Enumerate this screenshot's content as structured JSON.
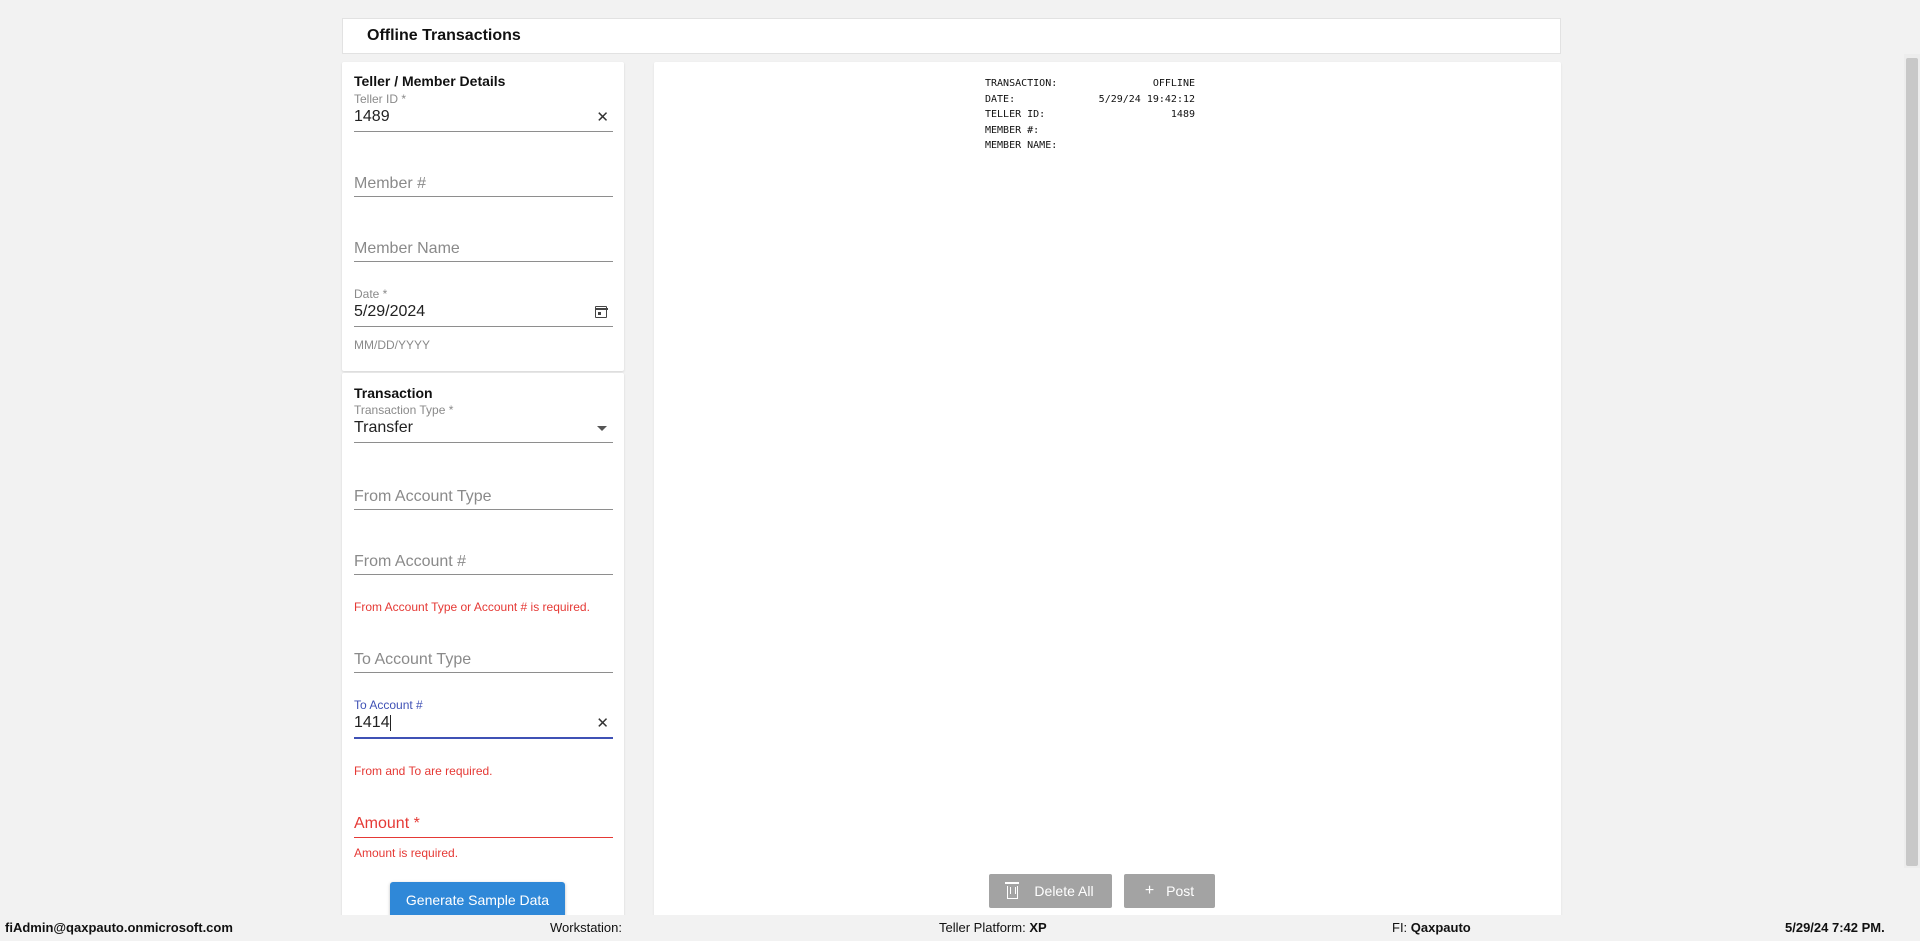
{
  "page_title": "Offline Transactions",
  "teller_section": {
    "title": "Teller / Member Details",
    "teller_id": {
      "label": "Teller ID *",
      "value": "1489"
    },
    "member_number": {
      "placeholder": "Member #"
    },
    "member_name": {
      "placeholder": "Member Name"
    },
    "date": {
      "label": "Date *",
      "value": "5/29/2024",
      "hint": "MM/DD/YYYY"
    }
  },
  "transaction_section": {
    "title": "Transaction",
    "transaction_type": {
      "label": "Transaction Type *",
      "value": "Transfer"
    },
    "from_account_type": {
      "placeholder": "From Account Type"
    },
    "from_account_number": {
      "placeholder": "From Account #",
      "error": "From Account Type or Account # is required."
    },
    "to_account_type": {
      "placeholder": "To Account Type"
    },
    "to_account_number": {
      "label": "To Account #",
      "value": "1414",
      "error": "From and To are required."
    },
    "amount": {
      "placeholder": "Amount *",
      "error": "Amount is required."
    },
    "generate_label": "Generate Sample Data"
  },
  "receipt": {
    "rows": [
      {
        "label": "TRANSACTION:",
        "value": "OFFLINE"
      },
      {
        "label": "DATE:",
        "value": "5/29/24 19:42:12"
      },
      {
        "label": "TELLER ID:",
        "value": "1489"
      },
      {
        "label": "MEMBER #:",
        "value": ""
      },
      {
        "label": "MEMBER NAME:",
        "value": ""
      }
    ]
  },
  "actions": {
    "delete_all": "Delete All",
    "post": "Post"
  },
  "status_bar": {
    "user": "fiAdmin@qaxpauto.onmicrosoft.com",
    "workstation_label": "Workstation:",
    "workstation_value": "",
    "platform_label": "Teller Platform:",
    "platform_value": "XP",
    "fi_label": "FI:",
    "fi_value": "Qaxpauto",
    "datetime": "5/29/24 7:42 PM."
  },
  "colors": {
    "accent": "#3f51b5",
    "error": "#e53935",
    "primary_button": "#2f88d8",
    "disabled_button": "#a3a3a3"
  },
  "icons": [
    "clear-icon",
    "calendar-icon",
    "dropdown-arrow-icon",
    "trash-icon",
    "plus-icon"
  ]
}
